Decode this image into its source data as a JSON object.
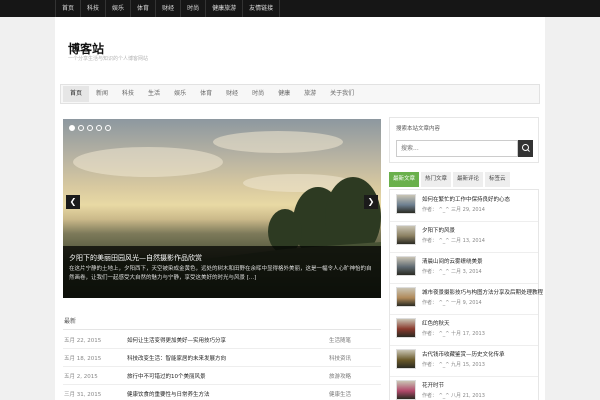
{
  "topbar": [
    "首页",
    "科技",
    "娱乐",
    "体育",
    "财经",
    "时尚",
    "健康旅游",
    "友情链接"
  ],
  "site": {
    "title": "博客站",
    "description": "一个分享生活与知识的个人博客网站"
  },
  "menu": [
    "首页",
    "新闻",
    "科技",
    "生活",
    "娱乐",
    "体育",
    "财经",
    "时尚",
    "健康",
    "旅游",
    "关于我们"
  ],
  "slider": {
    "dots": 5,
    "active_dot": 0,
    "prev": "❮",
    "next": "❯",
    "caption_title": "夕阳下的美丽田园风光—自然摄影作品欣赏",
    "caption_text": "在这片宁静的土地上，夕阳西下，天空被染成金黄色，远处的树木和田野在余晖中显得格外美丽，这是一幅令人心旷神怡的自然画卷，让我们一起感受大自然的魅力与宁静，享受这美好的时光与风景 [...]"
  },
  "list": {
    "heading": "最新",
    "rows": [
      {
        "date": "五月 22, 2015",
        "title": "如何让生活变得更加美好—实用技巧分享",
        "cat": "生活随笔"
      },
      {
        "date": "五月 18, 2015",
        "title": "科技改变生活：智能家居的未来发展方向",
        "cat": "科技资讯"
      },
      {
        "date": "五月 2, 2015",
        "title": "旅行中不可错过的10个美丽风景",
        "cat": "旅游攻略"
      },
      {
        "date": "三月 31, 2015",
        "title": "健康饮食的重要性与日常养生方法",
        "cat": "健康生活"
      }
    ]
  },
  "sidebar": {
    "search_title": "搜索本站文章内容",
    "search_placeholder": "搜索...",
    "tabs": [
      "最新文章",
      "热门文章",
      "最新评论",
      "标签云"
    ],
    "active_tab": 0,
    "items": [
      {
        "title": "如何在繁忙的工作中保持良好的心态",
        "meta": "作者： ^_^ 三月 29, 2014",
        "thumb": "#6d7f90"
      },
      {
        "title": "夕阳下的风景",
        "meta": "作者： ^_^ 二月 13, 2014",
        "thumb": "#8b8062"
      },
      {
        "title": "清晨山间的云雾缭绕美景",
        "meta": "作者： ^_^ 二月 3, 2014",
        "thumb": "#5f6a72"
      },
      {
        "title": "城市夜景摄影技巧与构图方法分享及后期处理教程",
        "meta": "作者： ^_^ 一月 9, 2014",
        "thumb": "#b08a5a"
      },
      {
        "title": "红色的秋天",
        "meta": "作者： ^_^ 十月 17, 2013",
        "thumb": "#8a3a2e"
      },
      {
        "title": "古代钱币收藏鉴赏—历史文化传承",
        "meta": "作者： ^_^ 九月 15, 2013",
        "thumb": "#6a5a2a"
      },
      {
        "title": "花开时节",
        "meta": "作者： ^_^ 八月 21, 2013",
        "thumb": "#b0486a"
      }
    ]
  }
}
